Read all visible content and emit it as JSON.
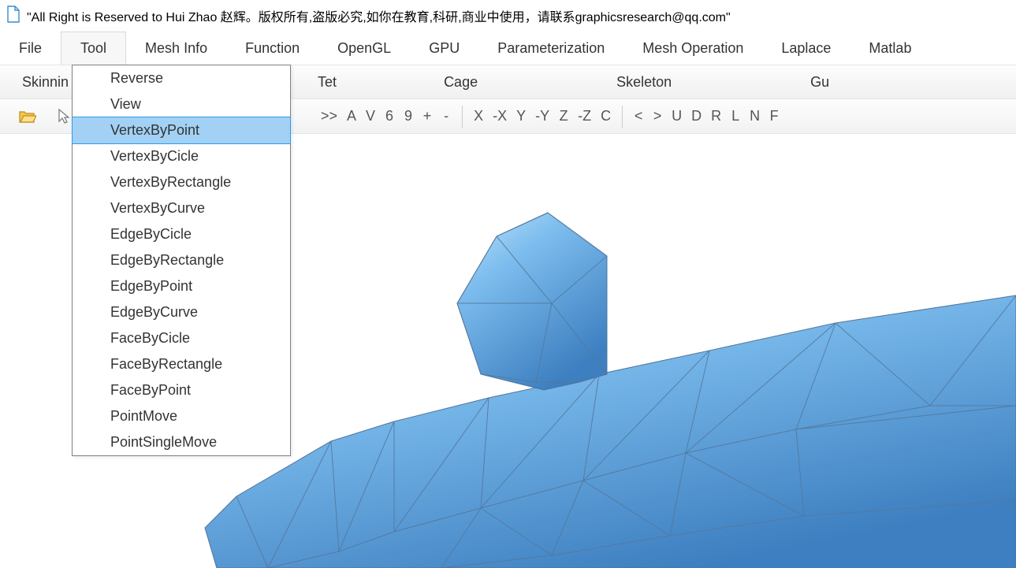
{
  "title": "\"All Right is Reserved to Hui Zhao 赵辉。版权所有,盗版必究,如你在教育,科研,商业中使用，请联系graphicsresearch@qq.com\"",
  "menu_row1": [
    {
      "label": "File",
      "active": false
    },
    {
      "label": "Tool",
      "active": true
    },
    {
      "label": "Mesh Info",
      "active": false
    },
    {
      "label": "Function",
      "active": false
    },
    {
      "label": "OpenGL",
      "active": false
    },
    {
      "label": "GPU",
      "active": false
    },
    {
      "label": "Parameterization",
      "active": false
    },
    {
      "label": "Mesh Operation",
      "active": false
    },
    {
      "label": "Laplace",
      "active": false
    },
    {
      "label": "Matlab",
      "active": false
    }
  ],
  "menu_row2": [
    "Skinnin",
    "Tet",
    "Cage",
    "Skeleton",
    "Gu"
  ],
  "toolbar": [
    ">>",
    "A",
    "V",
    "6",
    "9",
    "+",
    "-",
    "|SEP|",
    "X",
    "-X",
    "Y",
    "-Y",
    "Z",
    "-Z",
    "C",
    "|SEP|",
    "<",
    ">",
    "U",
    "D",
    "R",
    "L",
    "N",
    "F"
  ],
  "dropdown": {
    "items": [
      "Reverse",
      "View",
      "VertexByPoint",
      "VertexByCicle",
      "VertexByRectangle",
      "VertexByCurve",
      "EdgeByCicle",
      "EdgeByRectangle",
      "EdgeByPoint",
      "EdgeByCurve",
      "FaceByCicle",
      "FaceByRectangle",
      "FaceByPoint",
      "PointMove",
      "PointSingleMove"
    ],
    "highlighted_index": 2
  }
}
